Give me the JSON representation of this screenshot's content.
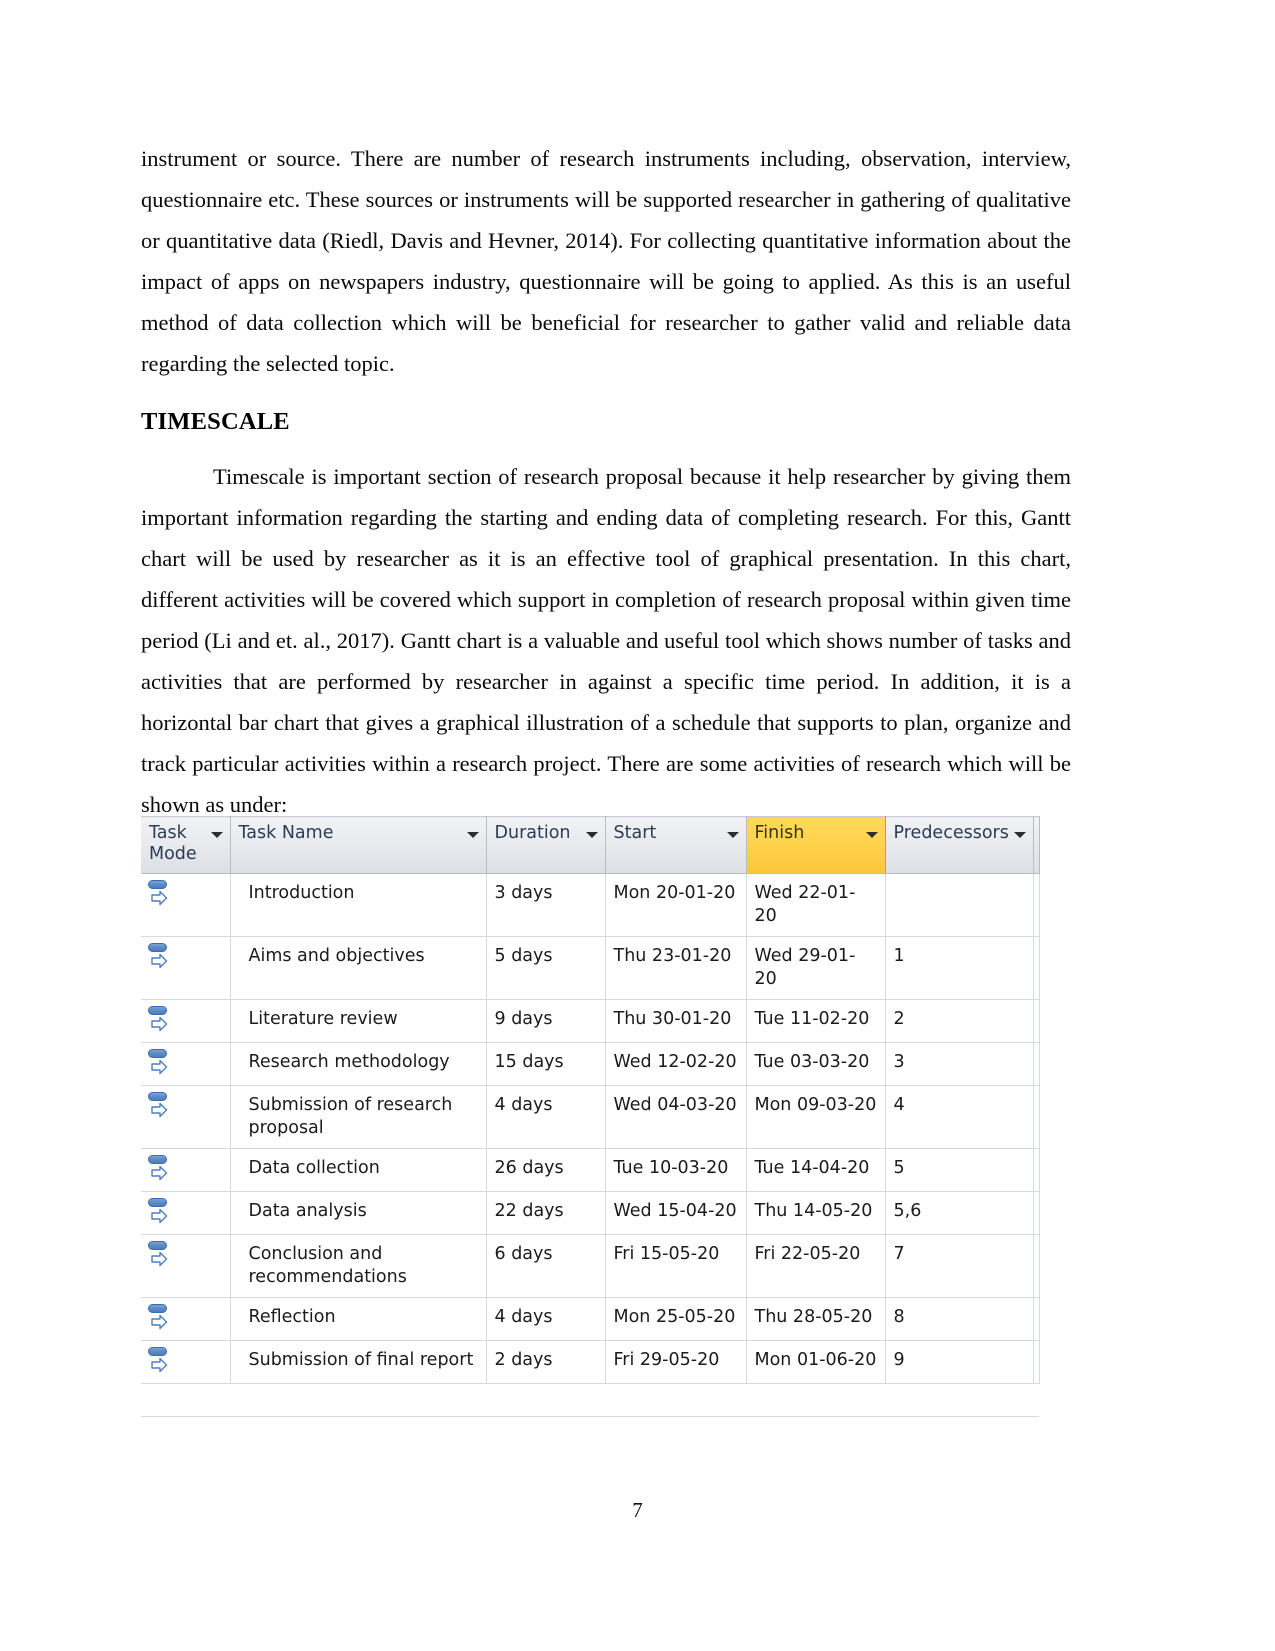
{
  "document": {
    "page_number": "7",
    "paragraphs": [
      {
        "id": "p1",
        "text": "instrument or source. There are number of research instruments including, observation, interview, questionnaire etc. These sources or instruments will be supported researcher in gathering of qualitative or quantitative data (Riedl, Davis and Hevner, 2014). For collecting quantitative information about the impact of apps on newspapers industry, questionnaire will be going to applied. As this is an useful method of data collection which will be beneficial for researcher to gather valid and reliable data regarding the selected topic."
      },
      {
        "id": "p2",
        "text": "Timescale is important section of research proposal because it help researcher by giving them important information regarding the starting and ending data of completing research. For this, Gantt chart will be used by researcher as it is an effective tool of graphical presentation. In this chart, different activities will be covered which support in completion of research proposal within given time period (Li and et. al., 2017). Gantt chart is a valuable and useful tool which shows number of tasks and activities that are performed by researcher in against a specific time period. In addition, it is a horizontal bar chart that gives a graphical illustration of a schedule that supports to plan, organize and track particular activities within a research project. There are some activities of research which will be shown as under:"
      }
    ],
    "heading": "TIMESCALE"
  },
  "project_table": {
    "columns": [
      {
        "key": "task_mode",
        "label": "Task Mode",
        "has_filter_arrow": true,
        "highlighted": false
      },
      {
        "key": "task_name",
        "label": "Task Name",
        "has_filter_arrow": true,
        "highlighted": false
      },
      {
        "key": "duration",
        "label": "Duration",
        "has_filter_arrow": true,
        "highlighted": false
      },
      {
        "key": "start",
        "label": "Start",
        "has_filter_arrow": true,
        "highlighted": false
      },
      {
        "key": "finish",
        "label": "Finish",
        "has_filter_arrow": true,
        "highlighted": true
      },
      {
        "key": "predecessors",
        "label": "Predecessors",
        "has_filter_arrow": true,
        "highlighted": false
      },
      {
        "key": "extra",
        "label": "",
        "has_filter_arrow": false,
        "highlighted": false
      }
    ],
    "highlight_color": "#ffd24a",
    "task_mode_icon": "auto-scheduled-icon",
    "rows": [
      {
        "task_mode": "auto-scheduled-icon",
        "task_name": "Introduction",
        "duration": "3 days",
        "start": "Mon 20-01-20",
        "finish": "Wed 22-01-20",
        "predecessors": ""
      },
      {
        "task_mode": "auto-scheduled-icon",
        "task_name": "Aims and objectives",
        "duration": "5 days",
        "start": "Thu 23-01-20",
        "finish": "Wed 29-01-20",
        "predecessors": "1"
      },
      {
        "task_mode": "auto-scheduled-icon",
        "task_name": "Literature review",
        "duration": "9 days",
        "start": "Thu 30-01-20",
        "finish": "Tue 11-02-20",
        "predecessors": "2"
      },
      {
        "task_mode": "auto-scheduled-icon",
        "task_name": "Research methodology",
        "duration": "15 days",
        "start": "Wed 12-02-20",
        "finish": "Tue 03-03-20",
        "predecessors": "3"
      },
      {
        "task_mode": "auto-scheduled-icon",
        "task_name": "Submission of research proposal",
        "duration": "4 days",
        "start": "Wed 04-03-20",
        "finish": "Mon 09-03-20",
        "predecessors": "4"
      },
      {
        "task_mode": "auto-scheduled-icon",
        "task_name": "Data collection",
        "duration": "26 days",
        "start": "Tue 10-03-20",
        "finish": "Tue 14-04-20",
        "predecessors": "5"
      },
      {
        "task_mode": "auto-scheduled-icon",
        "task_name": "Data analysis",
        "duration": "22 days",
        "start": "Wed 15-04-20",
        "finish": "Thu 14-05-20",
        "predecessors": "5,6"
      },
      {
        "task_mode": "auto-scheduled-icon",
        "task_name": "Conclusion and recommendations",
        "duration": "6 days",
        "start": "Fri 15-05-20",
        "finish": "Fri 22-05-20",
        "predecessors": "7"
      },
      {
        "task_mode": "auto-scheduled-icon",
        "task_name": "Reflection",
        "duration": "4 days",
        "start": "Mon 25-05-20",
        "finish": "Thu 28-05-20",
        "predecessors": "8"
      },
      {
        "task_mode": "auto-scheduled-icon",
        "task_name": "Submission of final report",
        "duration": "2 days",
        "start": "Fri 29-05-20",
        "finish": "Mon 01-06-20",
        "predecessors": "9"
      }
    ]
  }
}
